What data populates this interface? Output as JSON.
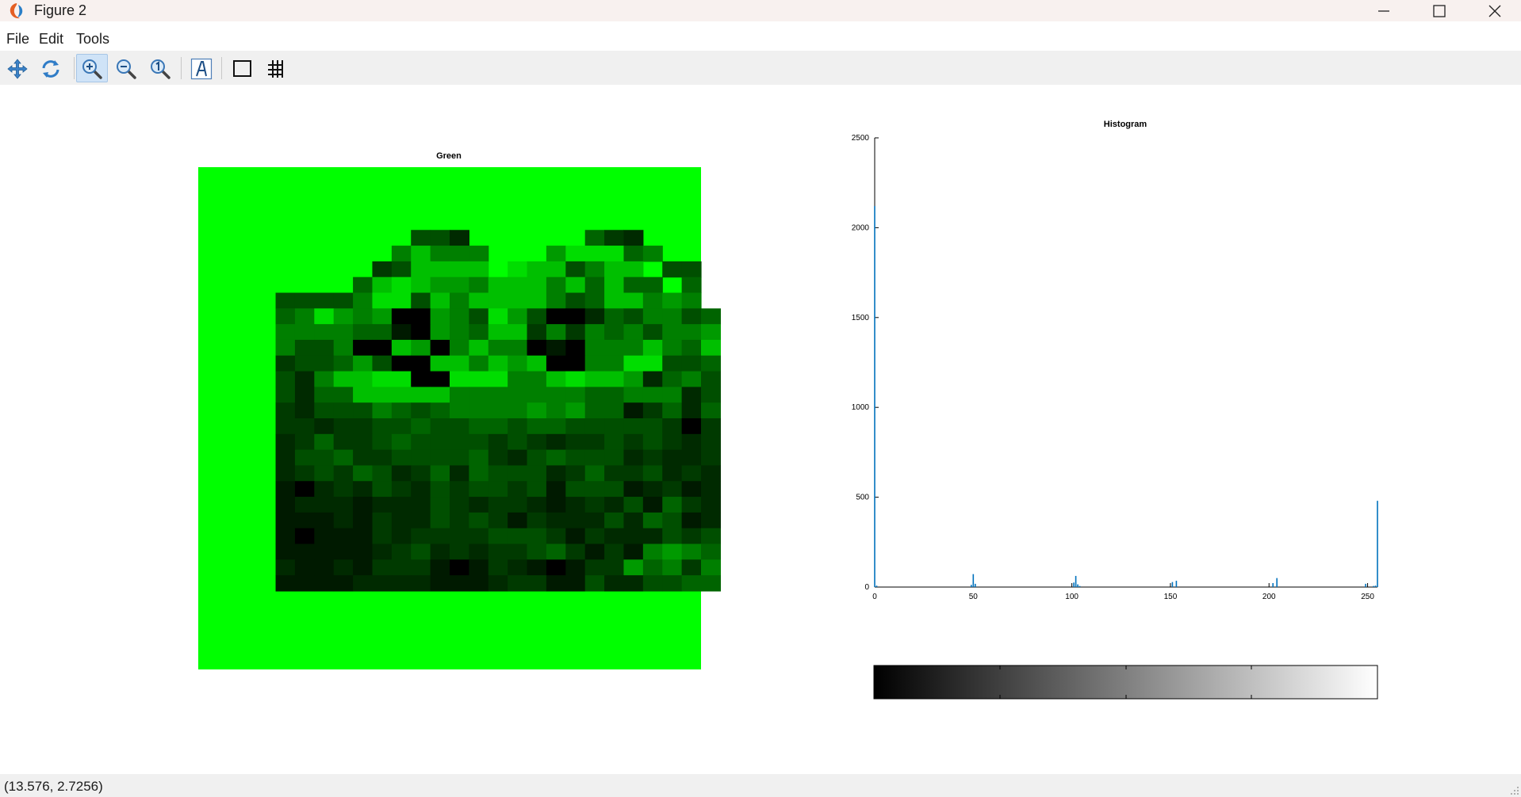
{
  "window": {
    "title": "Figure 2"
  },
  "menu": {
    "items": [
      "File",
      "Edit",
      "Tools"
    ]
  },
  "toolbar": {
    "tools": [
      "pan-icon",
      "rotate-icon",
      "zoom-in-icon",
      "zoom-out-icon",
      "zoom-reset-icon",
      "text-insert-icon",
      "box-toggle-icon",
      "grid-toggle-icon"
    ],
    "active": "zoom-in-icon"
  },
  "status": {
    "coordinates": "(13.576, 2.7256)"
  },
  "image_panel": {
    "title": "Green",
    "background": "#00ff00",
    "pixel_levels": [
      "                          ",
      "                          ",
      "                          ",
      "                          ",
      "           442      532    ",
      "          68666   799956   ",
      "         348888 9884688 44 ",
      "        5898776888685855 5 ",
      "    4444699486888864588676 ",
      "    56976700764974002546645",
      "    66665510765883636564667",
      "    64460087068660106668658",
      "    34457400886878006699445",
      "    42688990099966898872564",
      "    42558888866666665566624",
      "    32444654566667675513525",
      "    33233445445545544444303",
      "    23533454444343233434323",
      "    24453344445324544423223",
      "    23435423525444235334232",
      "    10232432434434144412312",
      "    12221222432332123241532",
      "    11121322434313222425412",
      "    10111323333444313222434",
      "    11111234232334531316765",
      "    21121333101321013375636",
      "    11112222111233114224455",
      "                          ",
      "                          ",
      "                          ",
      "                          ",
      "                          "
    ]
  },
  "histogram": {
    "title": "Histogram",
    "colorbar": {
      "gradient": [
        "#000000",
        "#ffffff"
      ]
    }
  },
  "chart_data": {
    "type": "bar",
    "title": "Histogram",
    "xlabel": "",
    "ylabel": "",
    "xlim": [
      0,
      255
    ],
    "ylim": [
      0,
      2500
    ],
    "xticks": [
      0,
      50,
      100,
      150,
      200,
      250
    ],
    "yticks": [
      0,
      500,
      1000,
      1500,
      2000,
      2500
    ],
    "color": "#0072bd",
    "x": [
      0,
      1,
      49,
      50,
      51,
      101,
      102,
      103,
      104,
      151,
      153,
      202,
      204,
      249,
      253,
      254,
      255
    ],
    "values": [
      2120,
      8,
      12,
      72,
      18,
      25,
      62,
      15,
      6,
      28,
      35,
      22,
      50,
      18,
      6,
      8,
      480
    ]
  }
}
